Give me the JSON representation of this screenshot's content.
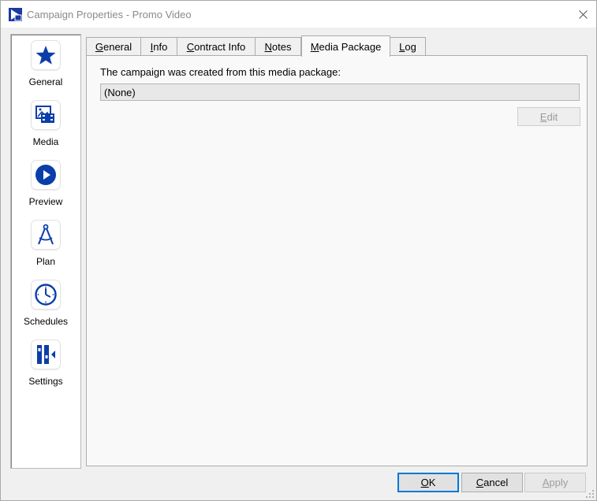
{
  "window": {
    "title": "Campaign Properties - Promo Video"
  },
  "sidebar": {
    "items": [
      {
        "label": "General",
        "icon": "star-icon"
      },
      {
        "label": "Media",
        "icon": "media-icon"
      },
      {
        "label": "Preview",
        "icon": "play-icon"
      },
      {
        "label": "Plan",
        "icon": "compass-icon"
      },
      {
        "label": "Schedules",
        "icon": "clock-icon"
      },
      {
        "label": "Settings",
        "icon": "settings-icon"
      }
    ]
  },
  "tabs": [
    {
      "label": "General",
      "mnemonic": "G",
      "rest": "eneral"
    },
    {
      "label": "Info",
      "mnemonic": "I",
      "rest": "nfo"
    },
    {
      "label": "Contract Info",
      "mnemonic": "C",
      "rest": "ontract Info"
    },
    {
      "label": "Notes",
      "mnemonic": "N",
      "rest": "otes"
    },
    {
      "label": "Media Package",
      "mnemonic": "M",
      "rest": "edia Package",
      "active": true
    },
    {
      "label": "Log",
      "mnemonic": "L",
      "rest": "og"
    }
  ],
  "panel": {
    "description": "The campaign was created from this media package:",
    "package_value": "(None)",
    "edit_button": {
      "mnemonic": "E",
      "rest": "dit"
    }
  },
  "footer": {
    "ok": {
      "mnemonic": "O",
      "rest": "K"
    },
    "cancel": {
      "mnemonic": "C",
      "rest": "ancel"
    },
    "apply": {
      "mnemonic": "A",
      "rest": "pply"
    }
  },
  "colors": {
    "accent": "#0a3ea9",
    "ok_border": "#0078d7"
  }
}
